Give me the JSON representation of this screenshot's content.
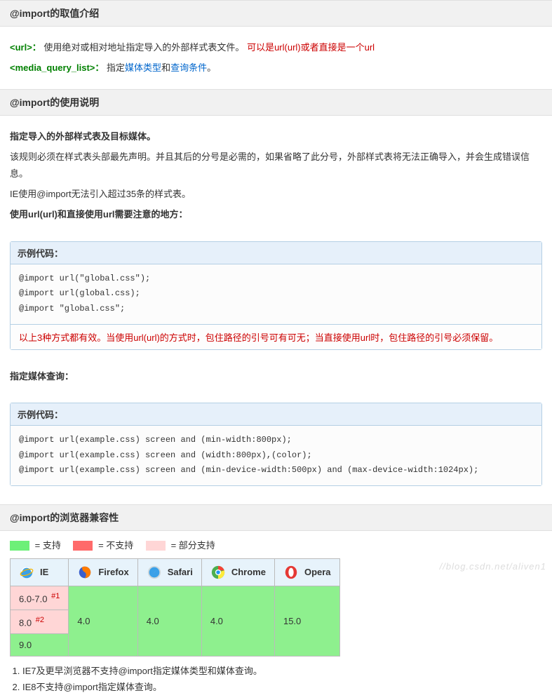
{
  "sections": {
    "values": {
      "title": "@import的取值介绍",
      "url_tag": "<url>：",
      "url_desc": "使用绝对或相对地址指定导入的外部样式表文件。",
      "url_note": "可以是url(url)或者直接是一个url",
      "media_tag": "<media_query_list>：",
      "media_prefix": "指定",
      "media_link1": "媒体类型",
      "media_and": "和",
      "media_link2": "查询条件",
      "media_end": "。"
    },
    "usage": {
      "title": "@import的使用说明",
      "p1_bold": "指定导入的外部样式表及目标媒体。",
      "p2": "该规则必须在样式表头部最先声明。并且其后的分号是必需的，如果省略了此分号，外部样式表将无法正确导入，并会生成错误信息。",
      "p3": "IE使用@import无法引入超过35条的样式表。",
      "p4_bold": "使用url(url)和直接使用url需要注意的地方：",
      "code1_title": "示例代码：",
      "code1": "@import url(\"global.css\");\n@import url(global.css);\n@import \"global.css\";",
      "code1_note": "以上3种方式都有效。当使用url(url)的方式时，包住路径的引号可有可无；当直接使用url时，包住路径的引号必须保留。",
      "p5_bold": "指定媒体查询：",
      "code2_title": "示例代码：",
      "code2": "@import url(example.css) screen and (min-width:800px);\n@import url(example.css) screen and (width:800px),(color);\n@import url(example.css) screen and (min-device-width:500px) and (max-device-width:1024px);"
    },
    "compat": {
      "title": "@import的浏览器兼容性",
      "legend": {
        "green": "= 支持",
        "red": "= 不支持",
        "pink": "= 部分支持"
      },
      "headers": {
        "ie": "IE",
        "ff": "Firefox",
        "sf": "Safari",
        "ch": "Chrome",
        "op": "Opera"
      },
      "rows": {
        "r1_ie": "6.0-7.0",
        "r1_sup": "#1",
        "r2_ie": "8.0",
        "r2_sup": "#2",
        "r3_ie": "9.0",
        "ff": "4.0",
        "sf": "4.0",
        "ch": "4.0",
        "op": "15.0"
      },
      "notes": {
        "n1": "IE7及更早浏览器不支持@import指定媒体类型和媒体查询。",
        "n2": "IE8不支持@import指定媒体查询。"
      }
    }
  },
  "watermark": "//blog.csdn.net/aliven1"
}
